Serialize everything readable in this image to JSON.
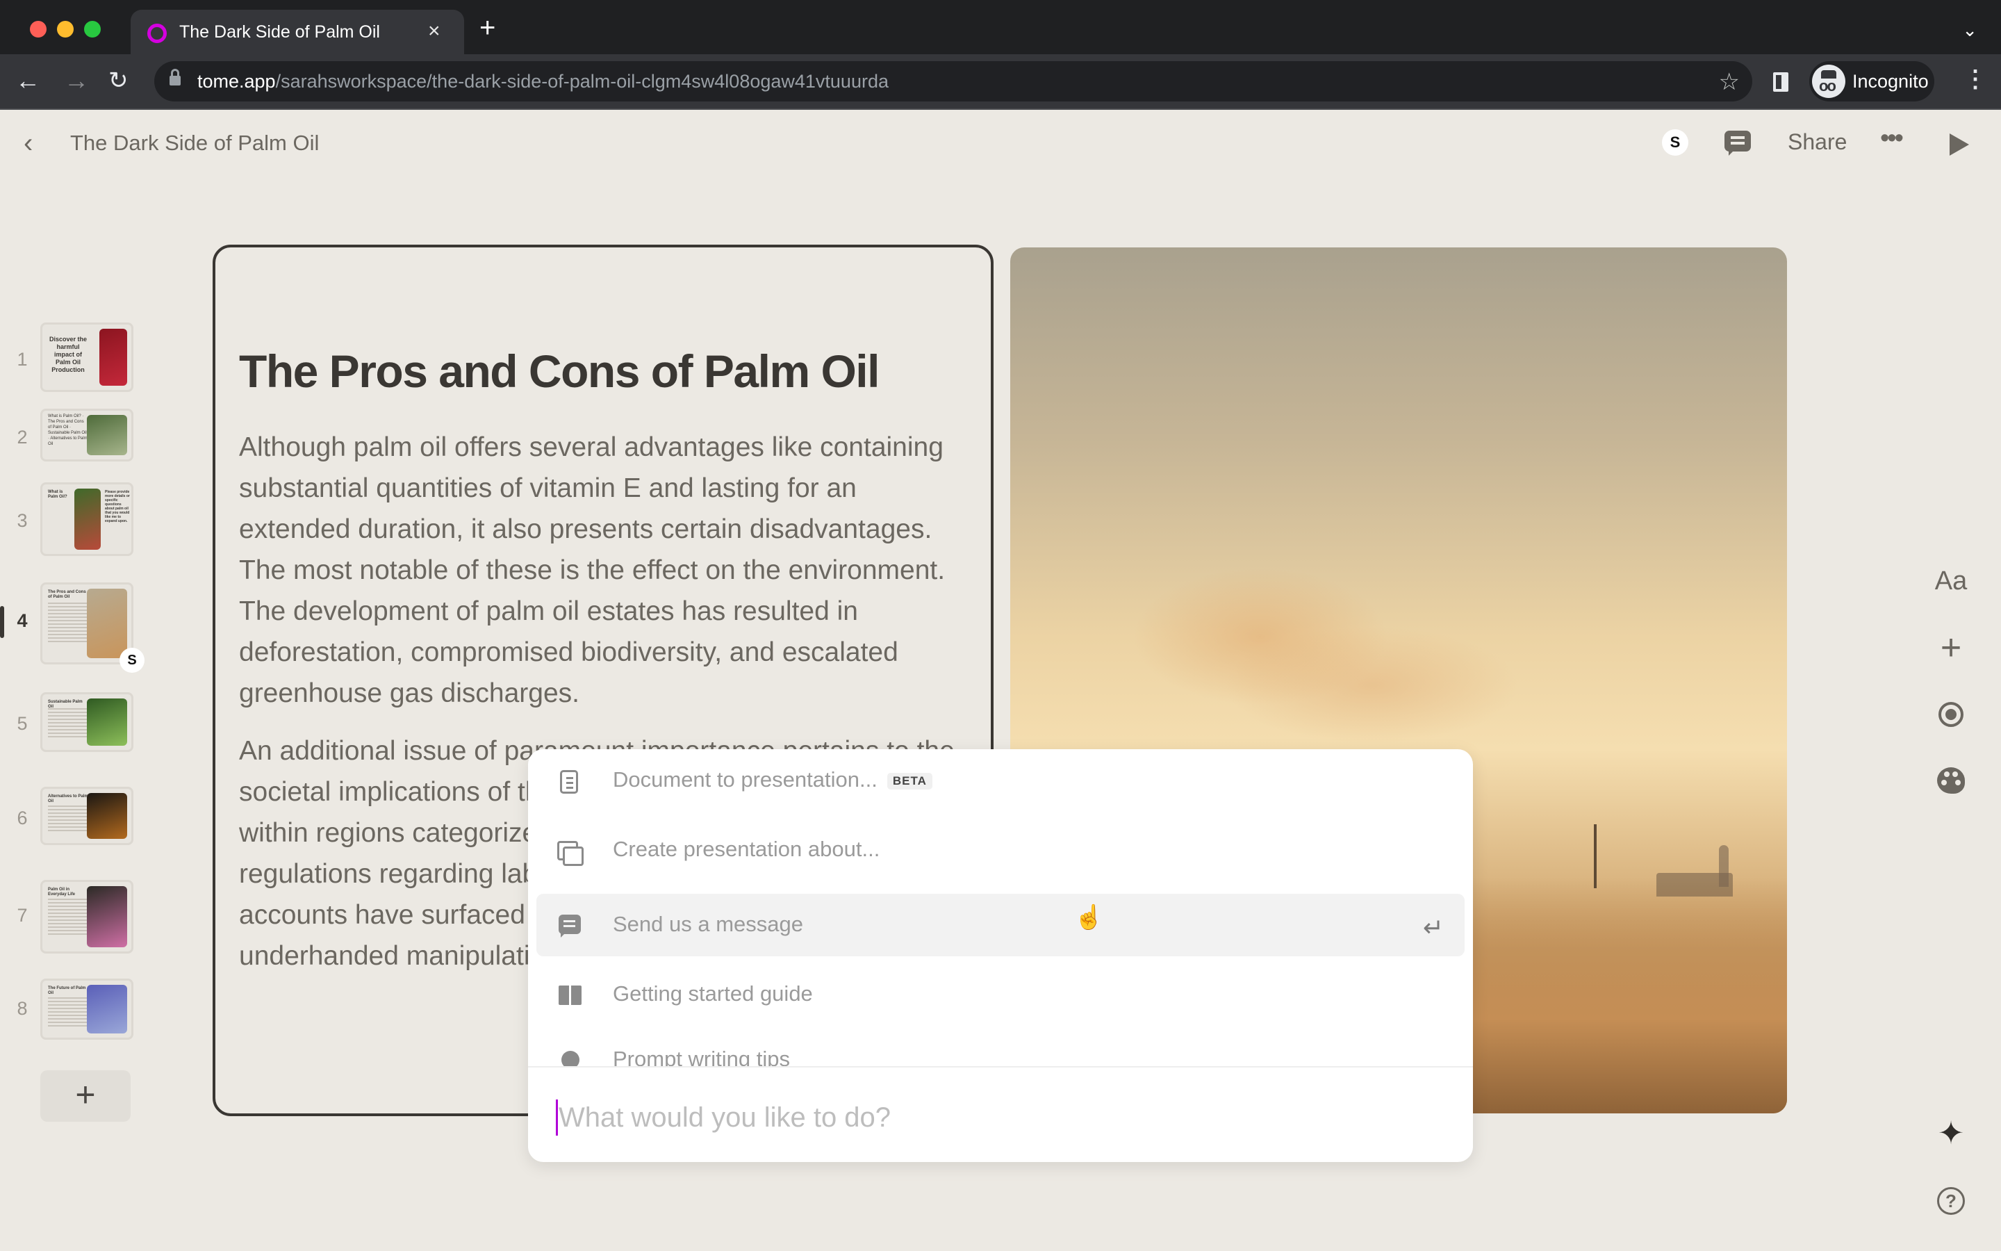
{
  "browser": {
    "tab_title": "The Dark Side of Palm Oil",
    "url_host": "tome.app",
    "url_path": "/sarahsworkspace/the-dark-side-of-palm-oil-clgm4sw4l08ogaw41vtuuurda",
    "profile_label": "Incognito",
    "icons": {
      "close_tab": "×",
      "new_tab": "+",
      "tab_list": "⌄",
      "back": "←",
      "forward": "→",
      "reload": "↻",
      "star": "☆",
      "menu": "⋮"
    }
  },
  "header": {
    "back_icon": "‹",
    "doc_title": "The Dark Side of Palm Oil",
    "avatar_initial": "S",
    "share_label": "Share",
    "more_icon": "•••"
  },
  "rail": {
    "active_index": 4,
    "slides": [
      {
        "number": "1",
        "title": "Discover the harmful impact of Palm Oil Production",
        "image_colors": [
          "#8c1520",
          "#c4283a"
        ]
      },
      {
        "number": "2",
        "title": "What is Palm Oil? · The Pros and Cons of Palm Oil · Sustainable Palm Oil · Alternatives to Palm Oil",
        "image_colors": [
          "#4e6b3a",
          "#a7b58c"
        ]
      },
      {
        "number": "3",
        "title": "What is Palm Oil?",
        "side_text": "Please provide more details or specific questions about palm oil that you would like me to expand upon.",
        "image_colors": [
          "#3f6a2a",
          "#b84a3a"
        ]
      },
      {
        "number": "4",
        "title": "The Pros and Cons of Palm Oil",
        "image_colors": [
          "#b7aa90",
          "#c9955b"
        ],
        "collaborator_initial": "S"
      },
      {
        "number": "5",
        "title": "Sustainable Palm Oil",
        "image_colors": [
          "#2f5a22",
          "#8dbf5a"
        ]
      },
      {
        "number": "6",
        "title": "Alternatives to Palm Oil",
        "image_colors": [
          "#1b1713",
          "#b36a1e"
        ]
      },
      {
        "number": "7",
        "title": "Palm Oil in Everyday Life",
        "image_colors": [
          "#2b2a25",
          "#cf6fa5"
        ]
      },
      {
        "number": "8",
        "title": "The Future of Palm Oil",
        "image_colors": [
          "#5a5fb8",
          "#9aa7d8"
        ]
      }
    ],
    "add_slide_icon": "+"
  },
  "slide": {
    "title": "The Pros and Cons of Palm Oil",
    "paragraphs": [
      "Although palm oil offers several advantages like containing substantial quantities of vitamin E and lasting for an extended duration, it also presents certain disadvantages. The most notable of these is the effect on the environment. The development of palm oil estates has resulted in deforestation, compromised biodiversity, and escalated greenhouse gas discharges.",
      "An additional issue of paramount importance pertains to the societal implications of the production of palm oil, principally within regions categorized as underdeveloped, where regulations regarding labor may not be enforced. Numerous accounts have surfaced about mistreatment and underhanded manipulation of workers."
    ]
  },
  "right_toolbar": {
    "text_style_label": "Aa",
    "add_icon": "+",
    "sparkle_icon": "✦"
  },
  "command_palette": {
    "items": [
      {
        "label": "Document to presentation...",
        "badge": "BETA",
        "icon": "document-icon"
      },
      {
        "label": "Create presentation about...",
        "icon": "slides-icon"
      },
      {
        "label": "Send us a message",
        "icon": "message-icon",
        "hovered": true,
        "shortcut_icon": "↵"
      },
      {
        "label": "Getting started guide",
        "icon": "book-icon"
      },
      {
        "label": "Prompt writing tips",
        "icon": "lightbulb-icon"
      }
    ],
    "input_placeholder": "What would you like to do?",
    "input_value": ""
  },
  "colors": {
    "app_background": "#ece9e3",
    "text_primary": "#3a3733",
    "text_secondary": "#6b6760",
    "caret_accent": "#b000d8",
    "favicon": "#d400e0"
  }
}
